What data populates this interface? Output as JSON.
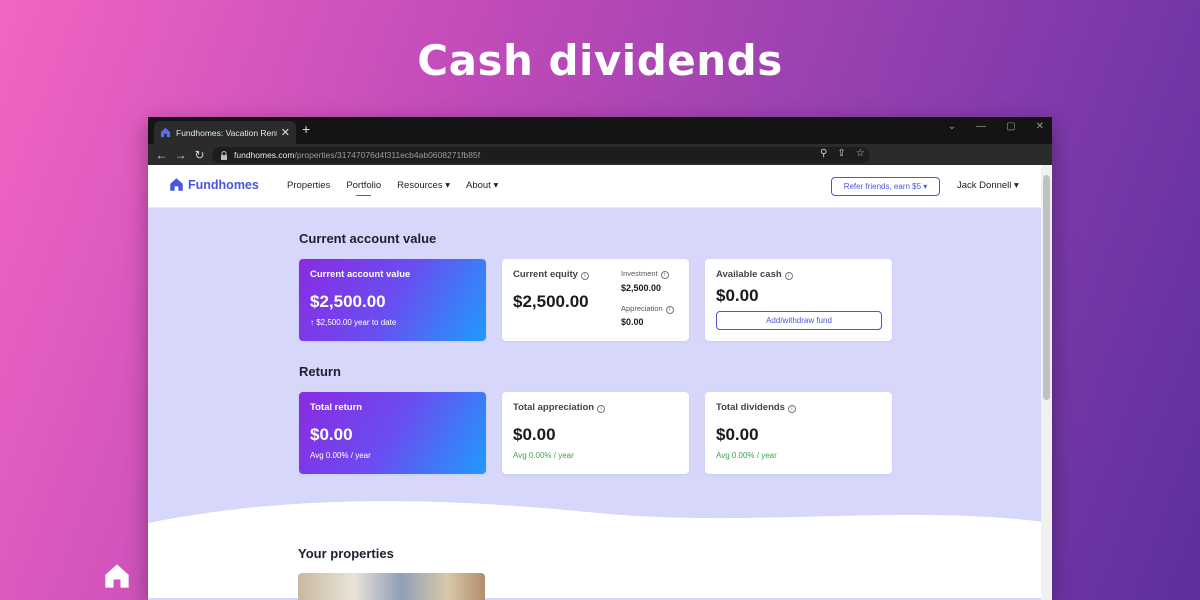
{
  "hero": {
    "title": "Cash dividends"
  },
  "browser": {
    "tab_title": "Fundhomes: Vacation Rental Inve",
    "tab_close": "✕",
    "new_tab": "+",
    "url_host": "fundhomes.com",
    "url_path": "/properties/31747076d4f311ecb4ab0608271fb85f"
  },
  "site": {
    "brand": "Fundhomes",
    "menu": [
      {
        "label": "Properties"
      },
      {
        "label": "Portfolio",
        "active": true
      },
      {
        "label": "Resources ▾"
      },
      {
        "label": "About ▾"
      }
    ],
    "refer_label": "Refer friends, earn $5 ▾",
    "user": "Jack Donnell ▾"
  },
  "account": {
    "section_title": "Current account value",
    "current": {
      "label": "Current account value",
      "value": "$2,500.00",
      "sub": "↑ $2,500.00 year to date"
    },
    "equity": {
      "label": "Current equity",
      "value": "$2,500.00",
      "investment_label": "Investment",
      "investment_value": "$2,500.00",
      "appreciation_label": "Appreciation",
      "appreciation_value": "$0.00"
    },
    "cash": {
      "label": "Available cash",
      "value": "$0.00",
      "button": "Add/withdraw fund"
    }
  },
  "return": {
    "section_title": "Return",
    "total": {
      "label": "Total return",
      "value": "$0.00",
      "sub": "Avg 0.00% / year"
    },
    "appreciation": {
      "label": "Total appreciation",
      "value": "$0.00",
      "sub": "Avg 0.00% / year"
    },
    "dividends": {
      "label": "Total dividends",
      "value": "$0.00",
      "sub": "Avg 0.00% / year"
    }
  },
  "properties": {
    "section_title": "Your properties"
  },
  "colors": {
    "accent": "#4a55e0",
    "page_bg": "#d6d7fb",
    "positive": "#3aa84a"
  },
  "icons": [
    "home-logo-icon",
    "back-arrow-icon",
    "forward-arrow-icon",
    "reload-icon",
    "lock-icon",
    "zoom-icon",
    "share-icon",
    "star-icon",
    "info-icon",
    "minimize-icon",
    "maximize-icon",
    "close-icon"
  ]
}
